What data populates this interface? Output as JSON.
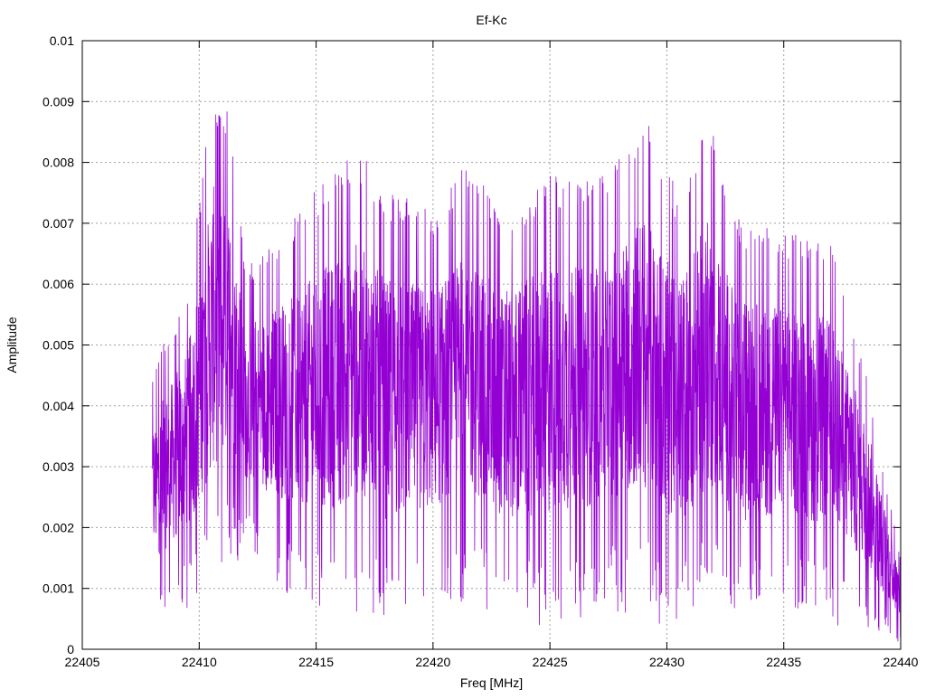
{
  "chart_data": {
    "type": "line",
    "title": "Ef-Kc",
    "xlabel": "Freq [MHz]",
    "ylabel": "Amplitude",
    "xlim": [
      22405,
      22440
    ],
    "ylim": [
      0,
      0.01
    ],
    "x_ticks": [
      "22405",
      "22410",
      "22415",
      "22420",
      "22425",
      "22430",
      "22435",
      "22440"
    ],
    "x_tick_values": [
      22405,
      22410,
      22415,
      22420,
      22425,
      22430,
      22435,
      22440
    ],
    "y_ticks": [
      "0",
      "0.001",
      "0.002",
      "0.003",
      "0.004",
      "0.005",
      "0.006",
      "0.007",
      "0.008",
      "0.009",
      "0.01"
    ],
    "y_tick_values": [
      0,
      0.001,
      0.002,
      0.003,
      0.004,
      0.005,
      0.006,
      0.007,
      0.008,
      0.009,
      0.01
    ],
    "grid": true,
    "legend": "none",
    "series": [
      {
        "color": "#9400D3",
        "x_start": 22408.0,
        "x_end": 22440.0,
        "envelope": {
          "x": [
            22408.0,
            22409.5,
            22410.6,
            22411.3,
            22412,
            22414,
            22416,
            22416.7,
            22418,
            22420,
            22421.5,
            22423,
            22425,
            22427,
            22429,
            22430.5,
            22431.8,
            22433,
            22435,
            22437,
            22438.5,
            22439.5,
            22440.0
          ],
          "high": [
            0.0046,
            0.006,
            0.0093,
            0.0089,
            0.0063,
            0.0071,
            0.008,
            0.0083,
            0.0075,
            0.0073,
            0.008,
            0.0072,
            0.0078,
            0.0077,
            0.0088,
            0.0075,
            0.0087,
            0.0071,
            0.0069,
            0.0067,
            0.0047,
            0.0025,
            0.0015
          ],
          "low": [
            0.0004,
            0.0006,
            0.0009,
            0.0013,
            0.0016,
            0.0008,
            0.0004,
            0.0006,
            0.0003,
            0.0006,
            0.0008,
            0.0005,
            0.0003,
            0.0006,
            0.0006,
            0.0002,
            0.0007,
            0.0004,
            0.0007,
            0.0004,
            0.0003,
            0.0002,
            0.0001
          ]
        }
      }
    ]
  }
}
